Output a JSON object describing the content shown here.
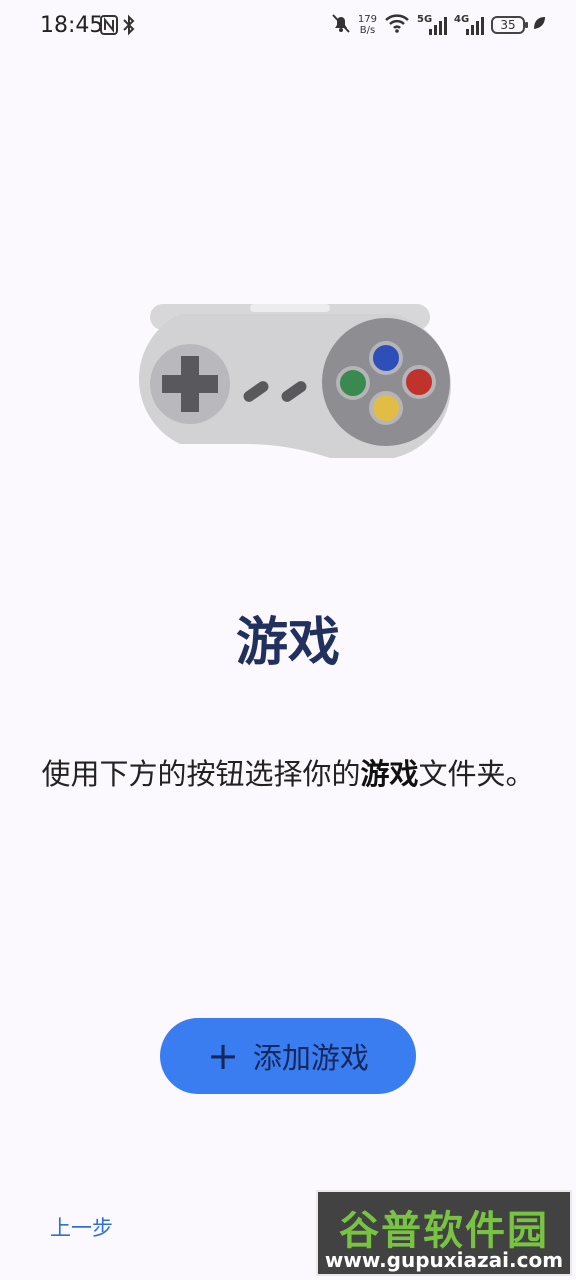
{
  "status_bar": {
    "time": "18:45",
    "net_speed_value": "179",
    "net_speed_unit": "B/s",
    "signal_1_label": "5G",
    "signal_2_label": "4G",
    "battery_level": "35",
    "icons": [
      "nfc-icon",
      "bluetooth-icon",
      "mute-icon",
      "wifi-icon",
      "signal-icon",
      "battery-icon",
      "leaf-icon"
    ]
  },
  "illustration": {
    "name": "game-controller",
    "button_colors": {
      "top": "#2e4fb8",
      "left": "#3a8a4f",
      "right": "#c0332d",
      "bottom": "#e2bd45"
    }
  },
  "main": {
    "title": "游戏",
    "description_prefix": "使用下方的按钮选择你的",
    "description_bold": "游戏",
    "description_suffix": "文件夹。",
    "add_button": {
      "icon": "+",
      "label": "添加游戏"
    },
    "back_label": "上一步"
  },
  "watermark": {
    "text": "谷普软件园",
    "url": "www.gupuxiazai.com"
  },
  "colors": {
    "background": "#fbf9fd",
    "title": "#22305e",
    "button": "#3a7df0",
    "link": "#2f6fd6"
  }
}
